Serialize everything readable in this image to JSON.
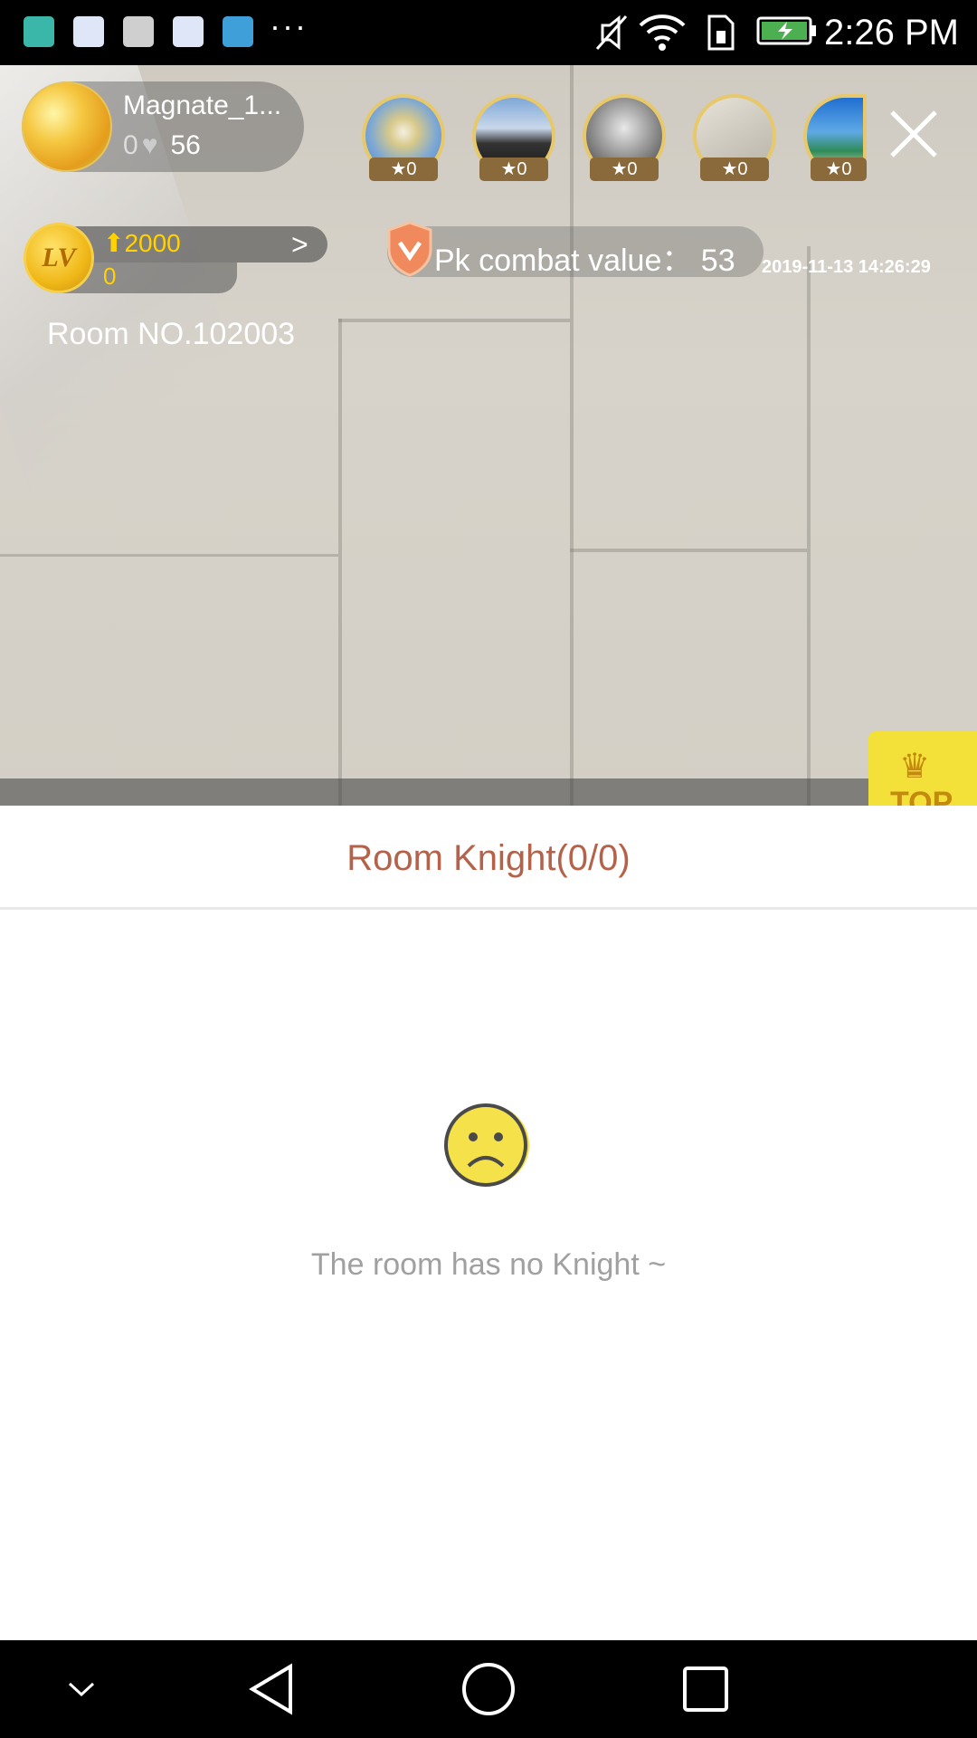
{
  "status_bar": {
    "time": "2:26 PM",
    "overflow": "···",
    "icons": [
      "android-icon",
      "baidu-icon",
      "font-a-icon",
      "baidu-icon",
      "map-icon",
      "mute-icon",
      "wifi-icon",
      "sim-icon",
      "battery-charging-icon"
    ]
  },
  "host": {
    "name": "Magnate_1...",
    "fans": "0",
    "likes": "56"
  },
  "viewers": [
    {
      "score": "0"
    },
    {
      "score": "0"
    },
    {
      "score": "0"
    },
    {
      "score": "0"
    },
    {
      "score": "0"
    }
  ],
  "level": {
    "badge": "LV",
    "up_value": "2000",
    "sub_value": "0"
  },
  "room": {
    "number": "Room NO.102003"
  },
  "pk": {
    "label": "Pk combat value：  53"
  },
  "timestamp": "2019-11-13 14:26:29",
  "top_badge": {
    "label": "TOP"
  },
  "panel": {
    "title": "Room Knight(0/0)",
    "empty_message": "The room has no Knight ~"
  },
  "colors": {
    "accent_title": "#b5624a",
    "gold": "#ffd200",
    "empty_text": "#a0a0a0"
  }
}
